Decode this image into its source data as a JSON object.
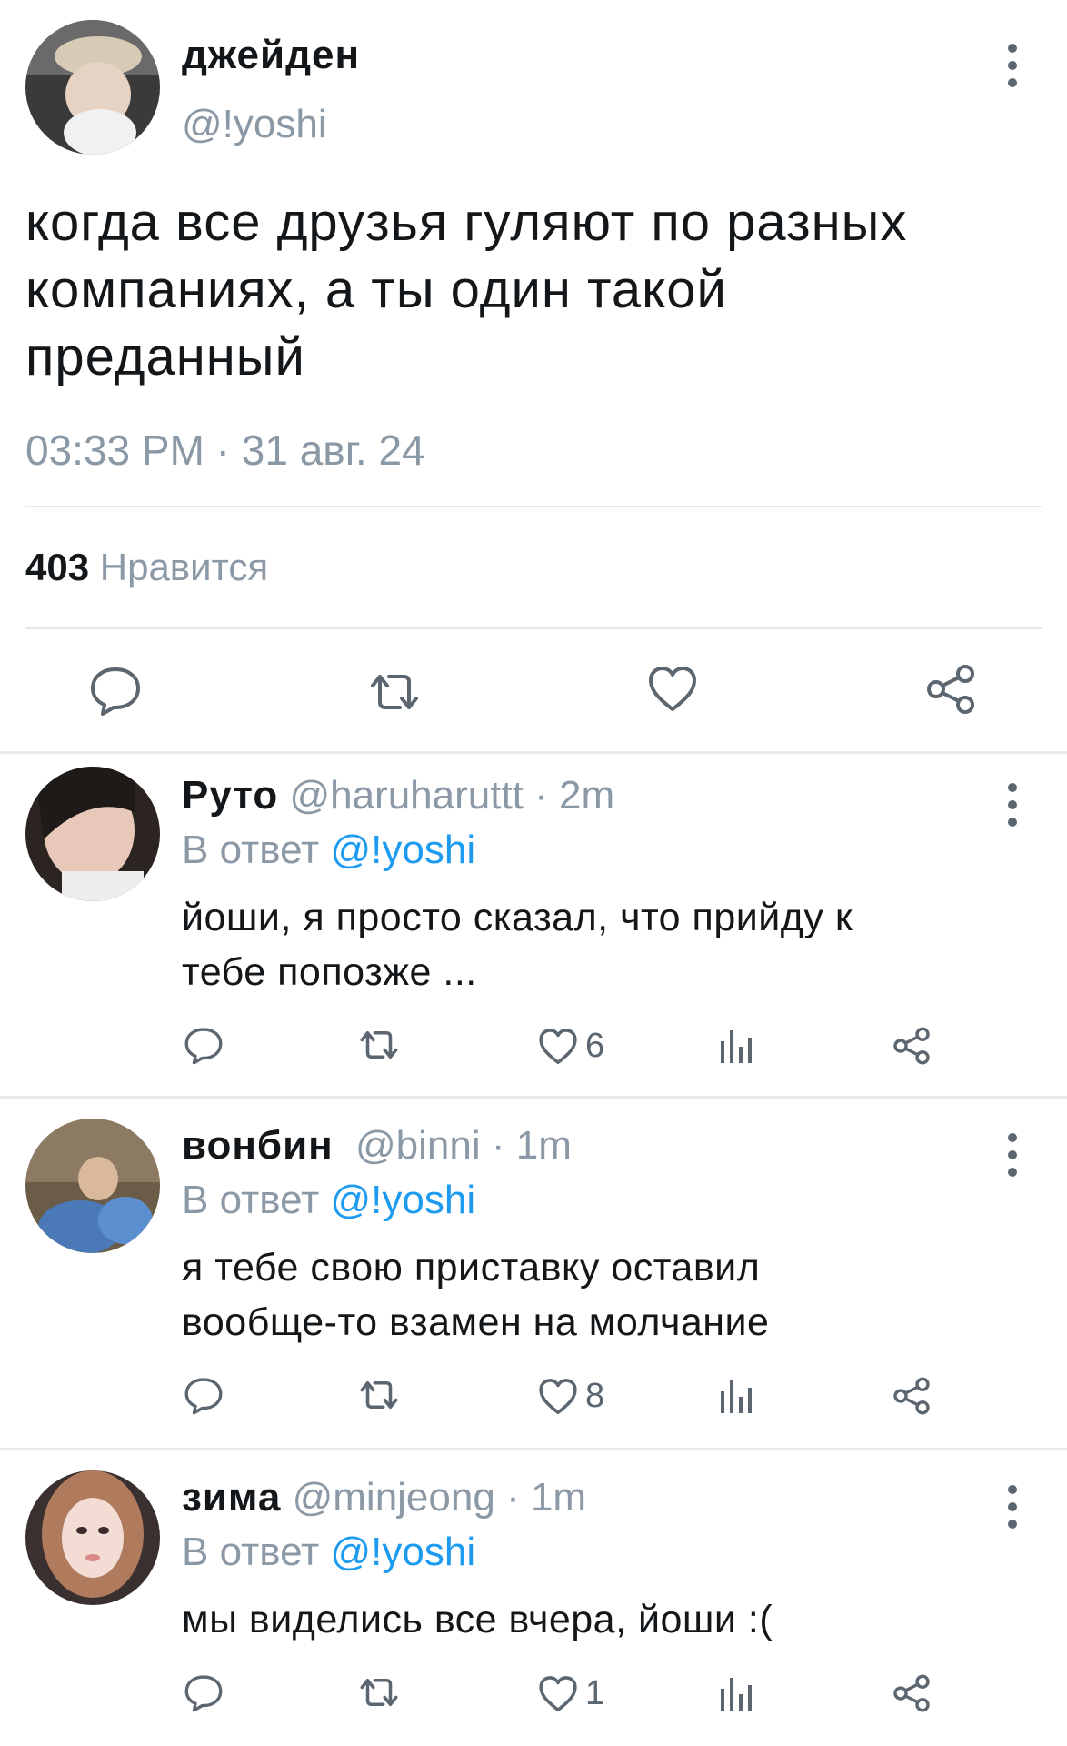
{
  "tweet": {
    "author_name": "джейден",
    "author_handle": "@!yoshi",
    "text_lines": [
      "когда все друзья гуляют по разных",
      "компаниях, а ты один такой",
      "преданный"
    ],
    "timestamp": "03:33 PM · 31 авг. 24",
    "likes_count": "403",
    "likes_label": "Нравится"
  },
  "replies": [
    {
      "name": "Руто",
      "handle": "@haruharuttt",
      "time": "· 2m",
      "reply_prefix": "В ответ",
      "reply_to": "@!yoshi",
      "text_lines": [
        "йоши, я просто сказал, что прийду к",
        "тебе попозже ..."
      ],
      "likes": "6"
    },
    {
      "name": "вонбин",
      "handle": "@binni",
      "time": "· 1m",
      "reply_prefix": "В ответ",
      "reply_to": "@!yoshi",
      "text_lines": [
        "я тебе свою приставку оставил",
        "вообще-то взамен на молчание"
      ],
      "likes": "8"
    },
    {
      "name": "зима",
      "handle": "@minjeong",
      "time": "· 1m",
      "reply_prefix": "В ответ",
      "reply_to": "@!yoshi",
      "text_lines": [
        "мы виделись все вчера, йоши :("
      ],
      "likes": "1"
    }
  ],
  "icons": {
    "more": "more-vertical-icon",
    "reply": "reply-icon",
    "retweet": "retweet-icon",
    "like": "heart-icon",
    "views": "views-icon",
    "share": "share-icon"
  },
  "colors": {
    "text": "#14171a",
    "muted": "#8b98a5",
    "accent": "#1d9bf0",
    "divider": "#e6e9ec"
  }
}
